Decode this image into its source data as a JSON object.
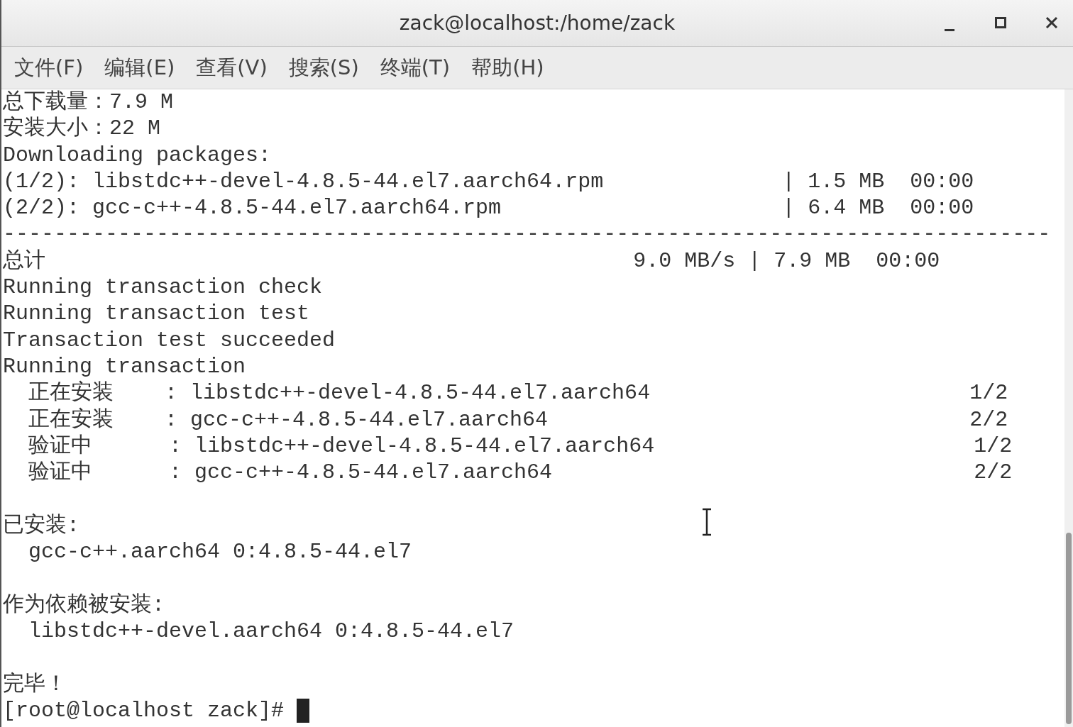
{
  "window": {
    "title": "zack@localhost:/home/zack"
  },
  "menu": [
    {
      "label": "文件(F)"
    },
    {
      "label": "编辑(E)"
    },
    {
      "label": "查看(V)"
    },
    {
      "label": "搜索(S)"
    },
    {
      "label": "终端(T)"
    },
    {
      "label": "帮助(H)"
    }
  ],
  "terminal": {
    "blocks": [
      {
        "lines": [
          "总下载量：7.9 M",
          "安装大小：22 M",
          "Downloading packages:",
          "(1/2): libstdc++-devel-4.8.5-44.el7.aarch64.rpm              | 1.5 MB  00:00",
          "(2/2): gcc-c++-4.8.5-44.el7.aarch64.rpm                      | 6.4 MB  00:00",
          "----------------------------------------------------------------------------------",
          "总计                                              9.0 MB/s | 7.9 MB  00:00",
          "Running transaction check",
          "Running transaction test",
          "Transaction test succeeded",
          "Running transaction",
          "  正在安装    : libstdc++-devel-4.8.5-44.el7.aarch64                         1/2",
          "  正在安装    : gcc-c++-4.8.5-44.el7.aarch64                                 2/2",
          "  验证中      : libstdc++-devel-4.8.5-44.el7.aarch64                         1/2",
          "  验证中      : gcc-c++-4.8.5-44.el7.aarch64                                 2/2"
        ]
      },
      {
        "lines": [
          "已安装:",
          "  gcc-c++.aarch64 0:4.8.5-44.el7"
        ]
      },
      {
        "lines": [
          "作为依赖被安装:",
          "  libstdc++-devel.aarch64 0:4.8.5-44.el7"
        ]
      },
      {
        "lines": [
          "完毕！"
        ]
      }
    ],
    "prompt": "[root@localhost zack]#"
  }
}
